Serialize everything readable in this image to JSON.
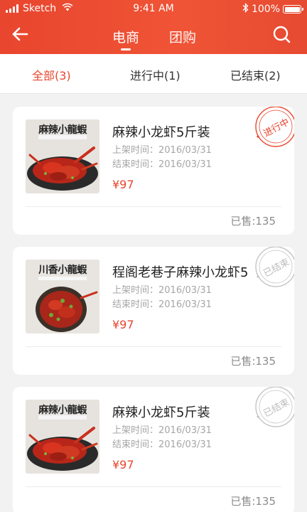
{
  "status_bar": {
    "carrier": "Sketch",
    "time": "9:41 AM",
    "battery": "100%"
  },
  "nav": {
    "tabs": [
      {
        "label": "电商"
      },
      {
        "label": "团购"
      }
    ]
  },
  "filters": [
    {
      "label": "全部(3)"
    },
    {
      "label": "进行中(1)"
    },
    {
      "label": "已结束(2)"
    }
  ],
  "products": [
    {
      "image_text": "麻辣小龍蝦",
      "title": "麻辣小龙虾5斤装",
      "list_time": "上架时间：2016/03/31",
      "end_time": "结束时间：2016/03/31",
      "price": "¥97",
      "sold": "已售:135",
      "status": "进行中",
      "status_color": "#e8462e"
    },
    {
      "image_text": "川香小龍蝦",
      "title": "程阁老巷子麻辣小龙虾5",
      "list_time": "上架时间：2016/03/31",
      "end_time": "结束时间：2016/03/31",
      "price": "¥97",
      "sold": "已售:135",
      "status": "已结束",
      "status_color": "#bdbdbd"
    },
    {
      "image_text": "麻辣小龍蝦",
      "title": "麻辣小龙虾5斤装",
      "list_time": "上架时间：2016/03/31",
      "end_time": "结束时间：2016/03/31",
      "price": "¥97",
      "sold": "已售:135",
      "status": "已结束",
      "status_color": "#bdbdbd"
    }
  ],
  "colors": {
    "accent": "#e8462e"
  }
}
